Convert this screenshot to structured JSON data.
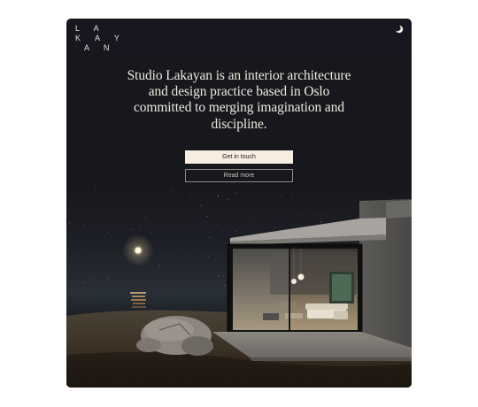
{
  "brand": {
    "logo_line1": "L A",
    "logo_line2": "K A Y",
    "logo_line3": "A N"
  },
  "header": {
    "theme_toggle_icon": "moon-icon"
  },
  "hero": {
    "headline": "Studio Lakayan is an interior architecture and design practice based in Oslo committed to merging imagination and discipline.",
    "primary_cta": "Get in touch",
    "secondary_cta": "Read more"
  },
  "colors": {
    "sky": "#17181f",
    "cream": "#f7ede1",
    "text": "#efe8de"
  }
}
